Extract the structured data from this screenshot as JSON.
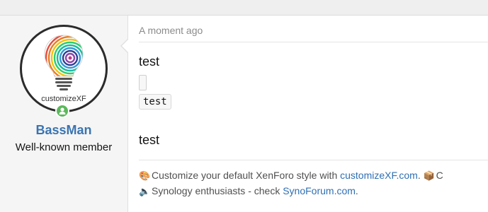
{
  "user": {
    "name": "BassMan",
    "title": "Well-known member",
    "avatar_label": "customizeXF",
    "status_icon": "person-online-icon"
  },
  "post": {
    "timestamp": "A moment ago",
    "lines": [
      "test",
      "test"
    ],
    "code": "test"
  },
  "signature": {
    "line1": {
      "icon": "palette-icon",
      "prefix": "Customize your default XenForo style with ",
      "link": "customizeXF.com",
      "suffix": ". ",
      "trail_icon": "package-icon",
      "trail_text": "C"
    },
    "line2": {
      "icon": "speaker-icon",
      "prefix": "Synology enthusiasts - check ",
      "link": "SynoForum.com",
      "suffix": "."
    }
  },
  "colors": {
    "username": "#3a74b0",
    "link": "#2f6fb3",
    "online": "#5cb85c"
  }
}
